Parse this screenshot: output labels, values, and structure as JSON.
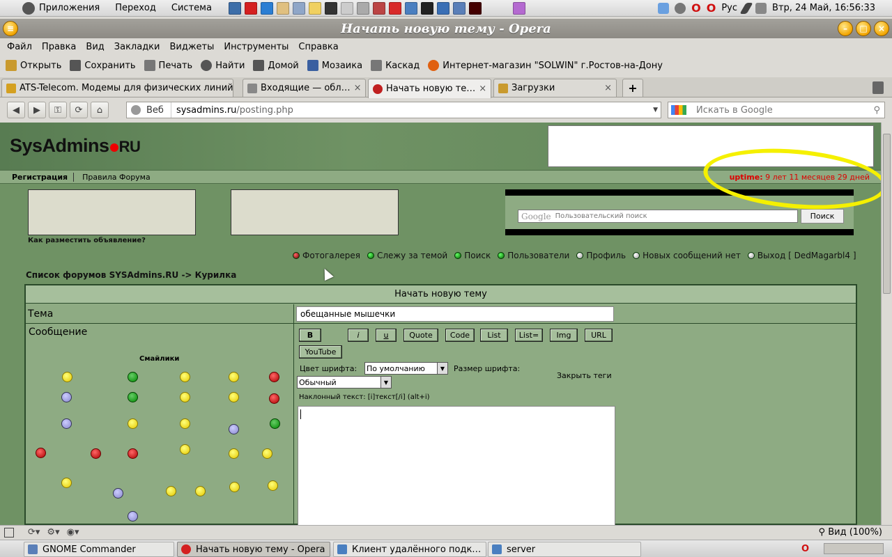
{
  "gnome": {
    "menus": [
      "Приложения",
      "Переход",
      "Система"
    ],
    "launcher_icons": [
      "monitor-icon",
      "opera-icon",
      "writer-icon",
      "notes-icon",
      "calc-icon",
      "editor-icon",
      "chart-icon",
      "terminal-icon",
      "disk-icon",
      "archive-icon",
      "filezilla-icon",
      "network-icon",
      "console-icon",
      "files-icon",
      "gimp-icon",
      "terminal-red-icon",
      "podcast-icon"
    ],
    "keyboard_layout": "Рус",
    "clock": "Втр, 24 Май, 16:56:33"
  },
  "window": {
    "title": "Начать новую тему - Opera"
  },
  "menubar": [
    "Файл",
    "Правка",
    "Вид",
    "Закладки",
    "Виджеты",
    "Инструменты",
    "Справка"
  ],
  "personal_bar": [
    {
      "label": "Открыть",
      "icon": "open-icon",
      "color": "#c99a2e"
    },
    {
      "label": "Сохранить",
      "icon": "save-icon",
      "color": "#555555"
    },
    {
      "label": "Печать",
      "icon": "print-icon",
      "color": "#777777"
    },
    {
      "label": "Найти",
      "icon": "find-icon",
      "color": "#555555"
    },
    {
      "label": "Домой",
      "icon": "home-icon",
      "color": "#555555"
    },
    {
      "label": "Мозаика",
      "icon": "tile-icon",
      "color": "#3a5fa0"
    },
    {
      "label": "Каскад",
      "icon": "cascade-icon",
      "color": "#777777"
    },
    {
      "label": "Интернет-магазин \"SOLWIN\" г.Ростов-на-Дону",
      "icon": "bookmark-icon",
      "color": "#e06010"
    }
  ],
  "tabs": [
    {
      "label": "ATS-Telecom. Модемы для физических линий",
      "active": false,
      "closable": false
    },
    {
      "label": "Входящие — обл…",
      "active": false,
      "closable": true
    },
    {
      "label": "Начать новую те…",
      "active": true,
      "closable": true
    },
    {
      "label": "Загрузки",
      "active": false,
      "closable": true
    }
  ],
  "address": {
    "web_label": "Веб",
    "url_host": "sysadmins.ru",
    "url_path": "/posting.php",
    "search_placeholder": "Искать в Google"
  },
  "page": {
    "logo_main": "SysAdmins",
    "logo_suffix": "RU",
    "nav_register": "Регистрация",
    "nav_rules": "Правила Форума",
    "uptime_label": "uptime:",
    "uptime_value": "9 лет 11 месяцев 29 дней",
    "ad_link": "Как разместить объявление?",
    "gsearch_logo": "Google",
    "gsearch_placeholder": "Пользовательский поиск",
    "gsearch_button": "Поиск",
    "user_links": [
      {
        "label": "Фотогалерея",
        "bullet": "red"
      },
      {
        "label": "Слежу за темой",
        "bullet": "green"
      },
      {
        "label": "Поиск",
        "bullet": "green"
      },
      {
        "label": "Пользователи",
        "bullet": "green"
      },
      {
        "label": "Профиль",
        "bullet": "white"
      },
      {
        "label": "Новых сообщений нет",
        "bullet": "white"
      },
      {
        "label": "Выход [ DedMagarbl4 ]",
        "bullet": "white"
      }
    ],
    "breadcrumb": "Список форумов SYSAdmins.RU -> Курилка",
    "form_title": "Начать новую тему",
    "subject_label": "Тема",
    "subject_value": "обещанные мышечки",
    "message_label": "Сообщение",
    "smilies_title": "Смайлики",
    "bbcode_buttons": [
      "B",
      "i",
      "u",
      "Quote",
      "Code",
      "List",
      "List=",
      "Img",
      "URL",
      "YouTube"
    ],
    "font_color_label": "Цвет шрифта:",
    "font_color_value": "По умолчанию",
    "font_size_label": "Размер шрифта:",
    "font_size_value": "Обычный",
    "close_tags": "Закрыть теги",
    "hint": "Наклонный текст: [i]текст[/i]  (alt+i)"
  },
  "statusbar": {
    "zoom": "Вид (100%)"
  },
  "taskbar": [
    {
      "label": "GNOME Commander",
      "icon": "commander-icon",
      "active": false
    },
    {
      "label": "Начать новую тему - Opera",
      "icon": "opera-icon",
      "active": true
    },
    {
      "label": "Клиент удалённого подк…",
      "icon": "remote-icon",
      "active": false
    },
    {
      "label": "server",
      "icon": "server-icon",
      "active": false
    }
  ],
  "colors": {
    "forum_bg": "#6f9264",
    "uptime": "#dd0000",
    "highlight": "#f5f000"
  }
}
